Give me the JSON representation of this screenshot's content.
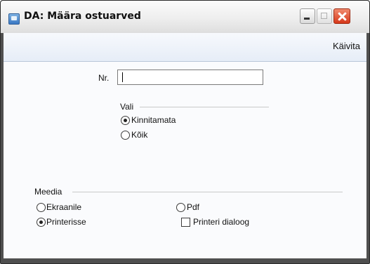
{
  "window": {
    "title": "DA: Määra ostuarved",
    "icon": "app-document-icon",
    "controls": {
      "minimize": "minimize-icon",
      "maximize": "maximize-icon",
      "close": "close-icon"
    }
  },
  "toolbar": {
    "run_label": "Käivita"
  },
  "form": {
    "nr": {
      "label": "Nr.",
      "value": ""
    },
    "vali": {
      "heading": "Vali",
      "options": [
        {
          "label": "Kinnitamata",
          "selected": true
        },
        {
          "label": "Kõik",
          "selected": false
        }
      ]
    },
    "meedia": {
      "heading": "Meedia",
      "options": [
        {
          "label": "Ekraanile",
          "selected": false
        },
        {
          "label": "Printerisse",
          "selected": true
        },
        {
          "label": "Pdf",
          "selected": false
        }
      ],
      "printer_dialog": {
        "label": "Printeri dialoog",
        "checked": false
      }
    }
  },
  "colors": {
    "title_bar": "#eeeeee",
    "toolbar": "#e6edf7",
    "close_button": "#d6381a",
    "frame": "#4f4f4f"
  }
}
